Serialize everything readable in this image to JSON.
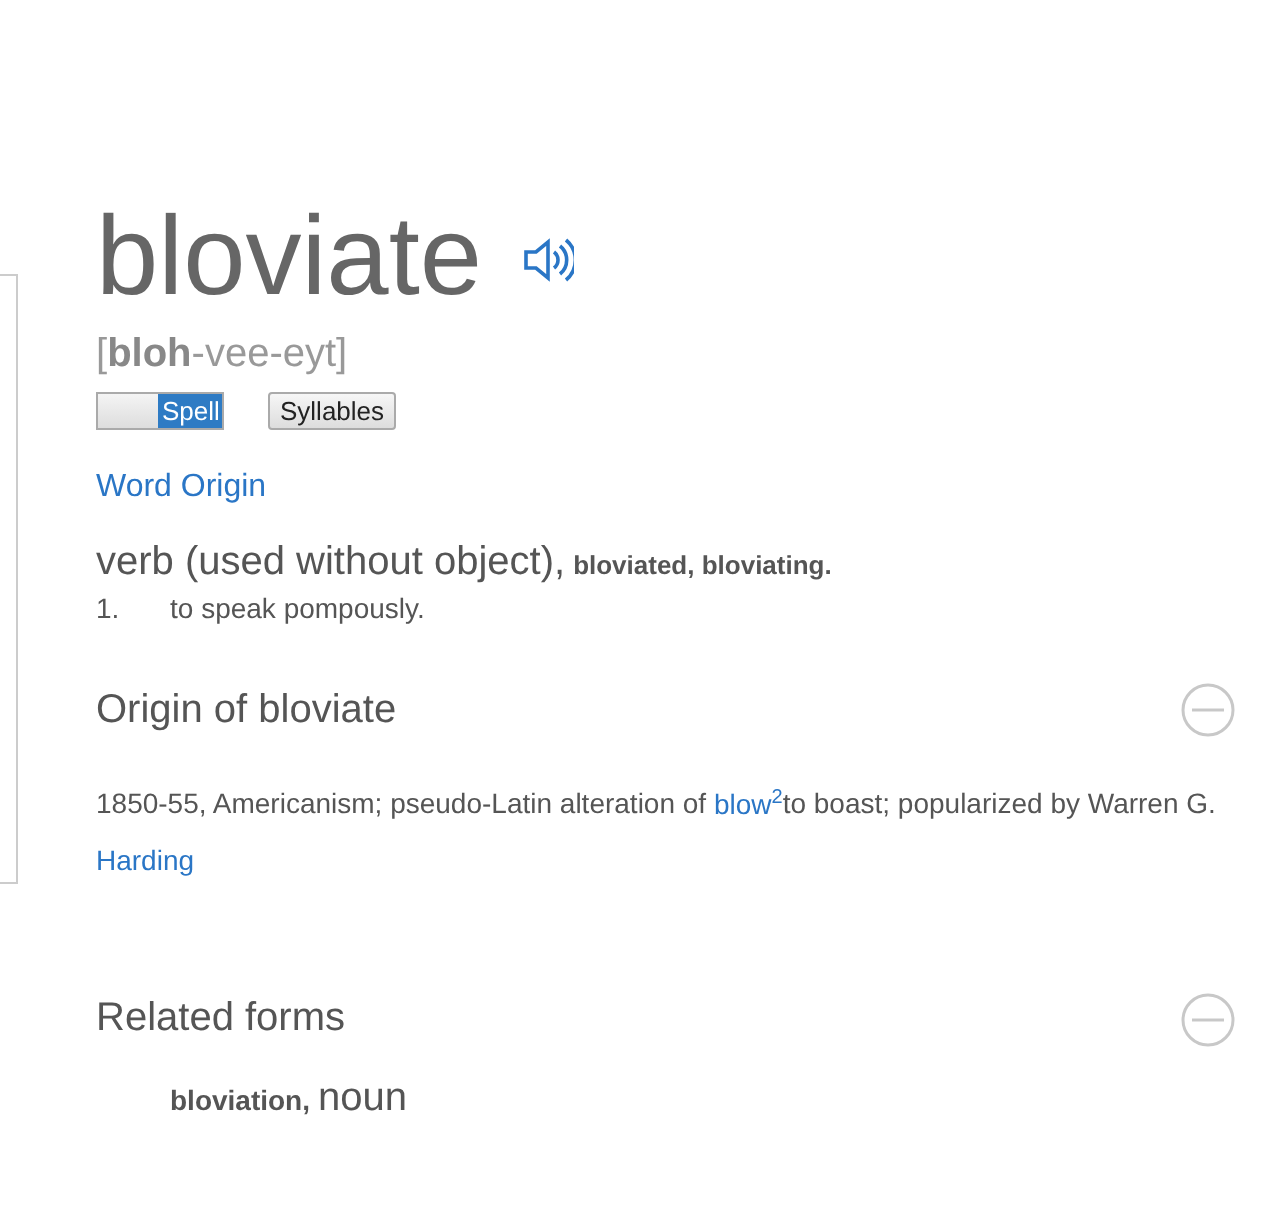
{
  "headword": "bloviate",
  "pronunciation": "[**bloh**-vee-eyt]",
  "spell_toggle": {
    "label": "Spell",
    "on": true
  },
  "syllables_button": "Syllables",
  "word_origin_link": "Word Origin",
  "definition": {
    "part_of_speech": "verb (used without object),",
    "forms": "bloviated, bloviating.",
    "senses": [
      {
        "number": "1.",
        "text": "to speak pompously."
      }
    ]
  },
  "sections": [
    {
      "title": "Origin of bloviate",
      "expanded": true,
      "kind": "origin",
      "parts": [
        {
          "kind": "text",
          "text": "1850-55, Americanism; pseudo-Latin alteration of "
        },
        {
          "kind": "link",
          "text": "blow$^{2}$"
        },
        {
          "kind": "text",
          "text": "to boast; popularized by Warren G. "
        },
        {
          "kind": "link",
          "text": "Harding"
        }
      ]
    },
    {
      "title": "Related forms",
      "expanded": true,
      "kind": "forms",
      "forms": [
        {
          "word": "bloviation,",
          "pos": "noun"
        }
      ]
    }
  ]
}
